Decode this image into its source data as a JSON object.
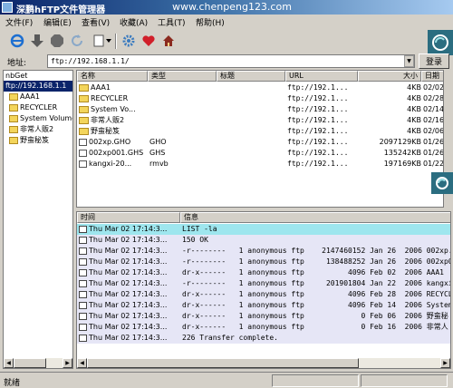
{
  "window": {
    "title": "深鹏hFTP文件管理器",
    "watermark": "www.chenpeng123.com"
  },
  "menu": [
    {
      "label": "文件(F)"
    },
    {
      "label": "编辑(E)"
    },
    {
      "label": "查看(V)"
    },
    {
      "label": "收藏(A)"
    },
    {
      "label": "工具(T)"
    },
    {
      "label": "帮助(H)"
    }
  ],
  "toolbar": {
    "icons": [
      "ie-connect-icon",
      "download-arrow-icon",
      "stop-icon",
      "refresh-icon",
      "new-document-icon",
      "settings-gear-icon",
      "favorites-heart-icon",
      "home-icon"
    ]
  },
  "address": {
    "label": "地址:",
    "value": "ftp://192.168.1.1/",
    "login_label": "登录"
  },
  "tree": {
    "root": "nbGet",
    "items": [
      {
        "label": "ftp://192.168.1.1",
        "selected": true,
        "folder": false
      },
      {
        "label": "AAA1",
        "selected": false,
        "folder": true
      },
      {
        "label": "RECYCLER",
        "selected": false,
        "folder": true
      },
      {
        "label": "System Volume",
        "selected": false,
        "folder": true
      },
      {
        "label": "非常人贩2",
        "selected": false,
        "folder": true
      },
      {
        "label": "野蛮秘笈",
        "selected": false,
        "folder": true
      }
    ]
  },
  "files": {
    "columns": [
      "名称",
      "类型",
      "标题",
      "URL",
      "大小",
      "日期"
    ],
    "rows": [
      {
        "name": "AAA1",
        "type": "",
        "title": "",
        "url": "ftp://192.1...",
        "size": "4KB",
        "date": "02/02/",
        "folder": true
      },
      {
        "name": "RECYCLER",
        "type": "",
        "title": "",
        "url": "ftp://192.1...",
        "size": "4KB",
        "date": "02/28/",
        "folder": true
      },
      {
        "name": "System Vo...",
        "type": "",
        "title": "",
        "url": "ftp://192.1...",
        "size": "4KB",
        "date": "02/14/",
        "folder": true
      },
      {
        "name": "非常人贩2",
        "type": "",
        "title": "",
        "url": "ftp://192.1...",
        "size": "4KB",
        "date": "02/16/",
        "folder": true
      },
      {
        "name": "野蛮秘笈",
        "type": "",
        "title": "",
        "url": "ftp://192.1...",
        "size": "4KB",
        "date": "02/06/",
        "folder": true
      },
      {
        "name": "002xp.GHO",
        "type": "GHO",
        "title": "",
        "url": "ftp://192.1...",
        "size": "2097129KB",
        "date": "01/26/",
        "folder": false
      },
      {
        "name": "002xp001.GHS",
        "type": "GHS",
        "title": "",
        "url": "ftp://192.1...",
        "size": "135242KB",
        "date": "01/26/",
        "folder": false
      },
      {
        "name": "kangxi-20...",
        "type": "rmvb",
        "title": "",
        "url": "ftp://192.1...",
        "size": "197169KB",
        "date": "01/22/",
        "folder": false
      }
    ]
  },
  "log": {
    "columns": [
      "时间",
      "信息"
    ],
    "rows": [
      {
        "time": "Thu Mar 02 17:14:3...",
        "info": "LIST -la",
        "highlight": true
      },
      {
        "time": "Thu Mar 02 17:14:3...",
        "info": "150 OK",
        "highlight": false
      },
      {
        "time": "Thu Mar 02 17:14:3...",
        "info": "-r--------   1 anonymous ftp    2147460152 Jan 26  2006 002xp.G",
        "highlight": false
      },
      {
        "time": "Thu Mar 02 17:14:3...",
        "info": "-r--------   1 anonymous ftp     138488252 Jan 26  2006 002xp0",
        "highlight": false
      },
      {
        "time": "Thu Mar 02 17:14:3...",
        "info": "dr-x------   1 anonymous ftp          4096 Feb 02  2006 AAA1",
        "highlight": false
      },
      {
        "time": "Thu Mar 02 17:14:3...",
        "info": "-r--------   1 anonymous ftp     201901804 Jan 22  2006 kangxi",
        "highlight": false
      },
      {
        "time": "Thu Mar 02 17:14:3...",
        "info": "dr-x------   1 anonymous ftp          4096 Feb 28  2006 RECYCL",
        "highlight": false
      },
      {
        "time": "Thu Mar 02 17:14:3...",
        "info": "dr-x------   1 anonymous ftp          4096 Feb 14  2006 System",
        "highlight": false
      },
      {
        "time": "Thu Mar 02 17:14:3...",
        "info": "dr-x------   1 anonymous ftp             0 Feb 06  2006 野蛮秘",
        "highlight": false
      },
      {
        "time": "Thu Mar 02 17:14:3...",
        "info": "dr-x------   1 anonymous ftp             0 Feb 16  2006 非常人",
        "highlight": false
      },
      {
        "time": "Thu Mar 02 17:14:3...",
        "info": "226 Transfer complete.",
        "highlight": false
      }
    ]
  },
  "status": {
    "text": "就绪"
  },
  "colors": {
    "title_start": "#0a246a",
    "selection": "#0a246a",
    "log_highlight": "#9ee6ee",
    "log_row": "#e6e6f6"
  }
}
